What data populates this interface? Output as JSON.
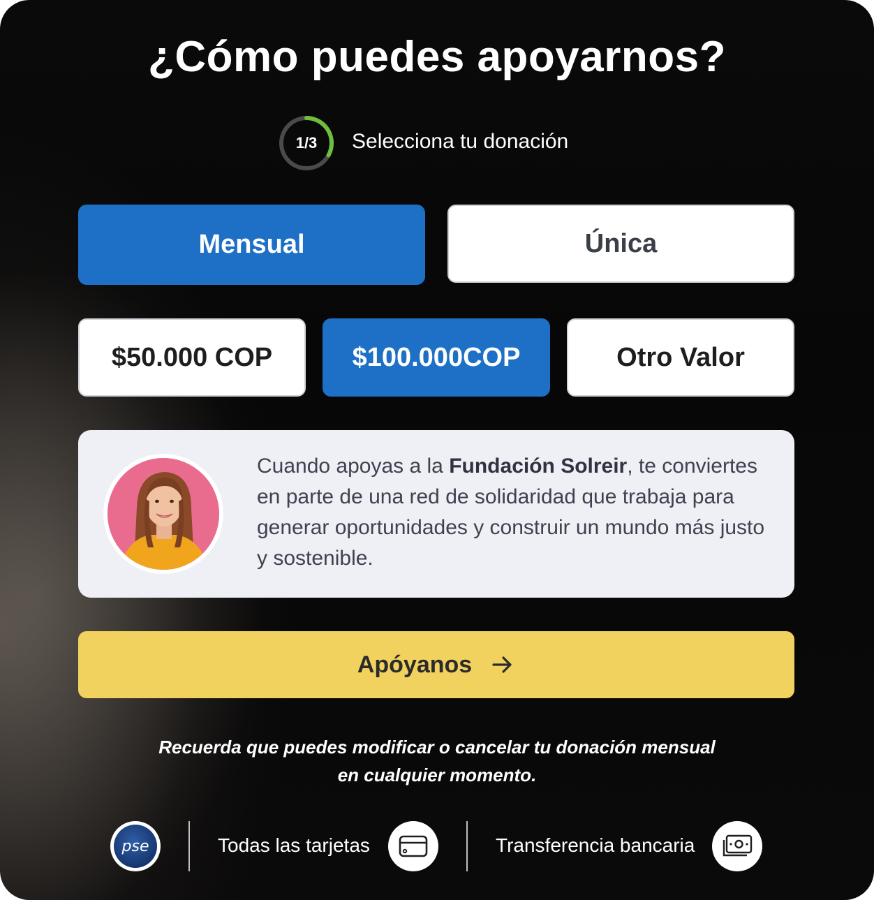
{
  "title": "¿Cómo puedes apoyarnos?",
  "step": {
    "current": "1/3",
    "progress": 0.33,
    "label": "Selecciona tu donación",
    "accent_color": "#6fbf3f"
  },
  "frequency": {
    "options": [
      "Mensual",
      "Única"
    ],
    "selected": "Mensual"
  },
  "amounts": {
    "options": [
      "$50.000 COP",
      "$100.000COP",
      "Otro Valor"
    ],
    "selected": "$100.000COP"
  },
  "info": {
    "text_before": "Cuando apoyas a la ",
    "org_name": "Fundación Solreir",
    "text_after": ", te conviertes en parte de una red de solidaridad que trabaja para generar oportunidades y construir un mundo más justo y sostenible."
  },
  "cta": {
    "label": "Apóyanos",
    "icon": "arrow-right-icon"
  },
  "note": {
    "line1": "Recuerda que puedes modificar o cancelar tu donación mensual",
    "line2": "en cualquier momento."
  },
  "payments": {
    "pse_logo_text": "pse",
    "cards_label": "Todas las tarjetas",
    "cards_icon": "credit-card-icon",
    "bank_label": "Transferencia bancaria",
    "bank_icon": "banknote-icon"
  },
  "colors": {
    "primary_blue": "#1d70c5",
    "cta_yellow": "#f2d25e",
    "info_bg": "#eff0f5"
  }
}
